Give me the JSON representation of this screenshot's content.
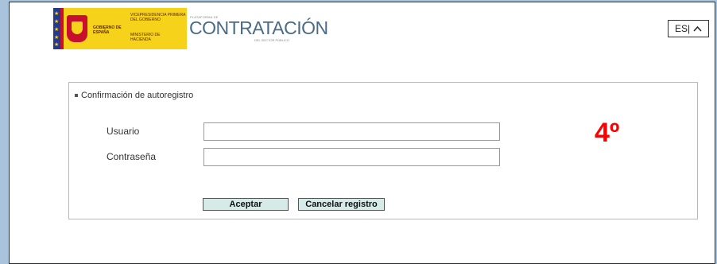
{
  "header": {
    "logo_gobierno": "GOBIERNO DE ESPAÑA",
    "logo_vicepresidencia": "VICEPRESIDENCIA PRIMERA DEL GOBIERNO",
    "logo_ministerio": "MINISTERIO DE HACIENDA",
    "brand_top": "PLATAFORMA DE",
    "brand_name": "CONTRATACIÓN",
    "brand_bottom": "DEL SECTOR PÚBLICO",
    "language": "ES|"
  },
  "panel": {
    "title": "Confirmación de autoregistro",
    "fields": {
      "usuario_label": "Usuario",
      "usuario_value": "",
      "password_label": "Contraseña",
      "password_value": ""
    },
    "buttons": {
      "accept": "Aceptar",
      "cancel": "Cancelar registro"
    }
  },
  "annotation": {
    "step": "4º",
    "color": "#ff0000"
  },
  "colors": {
    "logo_yellow": "#f7d21b",
    "brand_blue": "#4a6b86",
    "button_bg": "#d6ebe8",
    "page_bg": "#a9c3dc"
  }
}
